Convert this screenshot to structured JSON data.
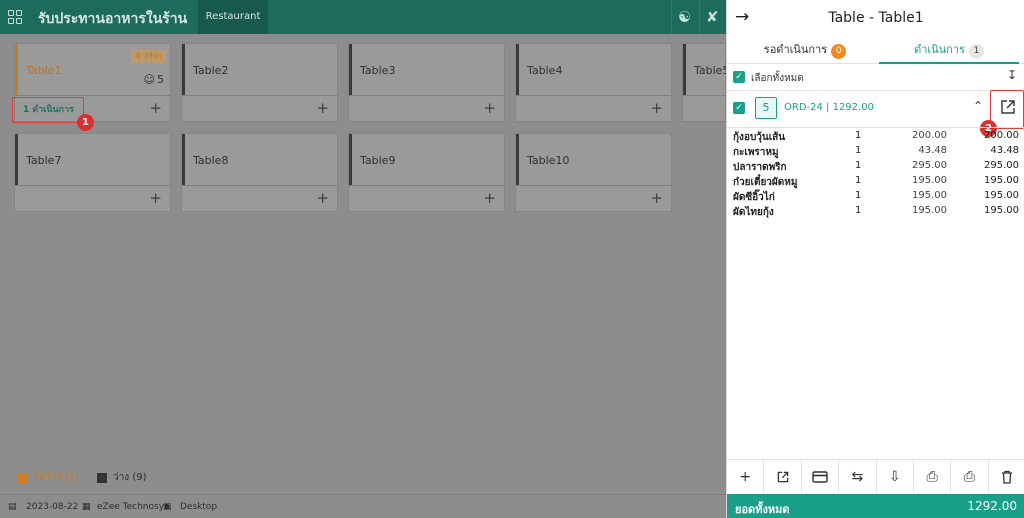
{
  "app": {
    "title": "รับประทานอาหารในร้าน",
    "tab": "Restaurant"
  },
  "tables": [
    {
      "name": "Table1",
      "time": "4 Min",
      "guests": "5",
      "running": "1 ดำเนินการ"
    },
    {
      "name": "Table2"
    },
    {
      "name": "Table3"
    },
    {
      "name": "Table4"
    },
    {
      "name": "Table5"
    },
    {
      "name": "Table7"
    },
    {
      "name": "Table8"
    },
    {
      "name": "Table9"
    },
    {
      "name": "Table10"
    }
  ],
  "legend": {
    "occupied": "ไม่ว่าง (1)",
    "free": "ว่าง (9)",
    "occupied_color": "#d27f22",
    "free_color": "#333333"
  },
  "footer": {
    "date": "2023-08-22",
    "company": "eZee Technosys",
    "device": "Desktop"
  },
  "panel": {
    "title": "Table - Table1",
    "tab_pending": "รอดำเนินการ",
    "tab_pending_count": "0",
    "tab_running": "ดำเนินการ",
    "tab_running_count": "1",
    "select_all": "เลือกทั้งหมด",
    "order_qty": "5",
    "order_id": "ORD-24 | 1292.00",
    "items": [
      {
        "name": "กุ้งอบวุ้นเส้น",
        "qty": "1",
        "price": "200.00",
        "total": "200.00"
      },
      {
        "name": "กะเพราหมู",
        "qty": "1",
        "price": "43.48",
        "total": "43.48"
      },
      {
        "name": "ปลาราดพริก",
        "qty": "1",
        "price": "295.00",
        "total": "295.00"
      },
      {
        "name": "ก๋วยเตี๋ยวผัดหมู",
        "qty": "1",
        "price": "195.00",
        "total": "195.00"
      },
      {
        "name": "ผัดซีอิ๊วไก่",
        "qty": "1",
        "price": "195.00",
        "total": "195.00"
      },
      {
        "name": "ผัดไทยกุ้ง",
        "qty": "1",
        "price": "195.00",
        "total": "195.00"
      }
    ],
    "total_label": "ยอดทั้งหมด",
    "total_value": "1292.00"
  },
  "annotations": [
    "1",
    "2"
  ],
  "colors": {
    "brand": "#1aa089",
    "header": "#1c6b5d",
    "orange": "#f08a1c",
    "marker": "#d93030"
  }
}
